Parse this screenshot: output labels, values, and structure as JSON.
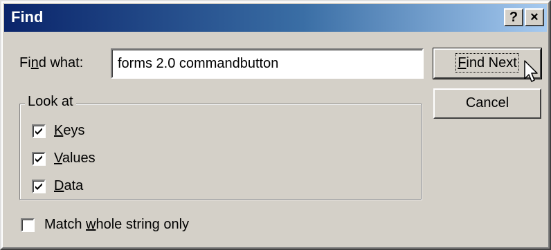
{
  "window": {
    "title": "Find",
    "help_label": "?",
    "close_label": "×"
  },
  "find": {
    "label_pre": "Fi",
    "label_u": "n",
    "label_post": "d what:",
    "value": "forms 2.0 commandbutton"
  },
  "buttons": {
    "find_next_u": "F",
    "find_next_rest": "ind Next",
    "cancel": "Cancel"
  },
  "look_at": {
    "title": "Look at",
    "options": [
      {
        "u": "K",
        "rest": "eys",
        "checked": true
      },
      {
        "u": "V",
        "rest": "alues",
        "checked": true
      },
      {
        "u": "D",
        "rest": "ata",
        "checked": true
      }
    ]
  },
  "match": {
    "pre": "Match ",
    "u": "w",
    "post": "hole string only",
    "checked": false
  },
  "icons": {
    "checkmark": "checkmark-icon",
    "cursor": "mouse-pointer-icon"
  }
}
